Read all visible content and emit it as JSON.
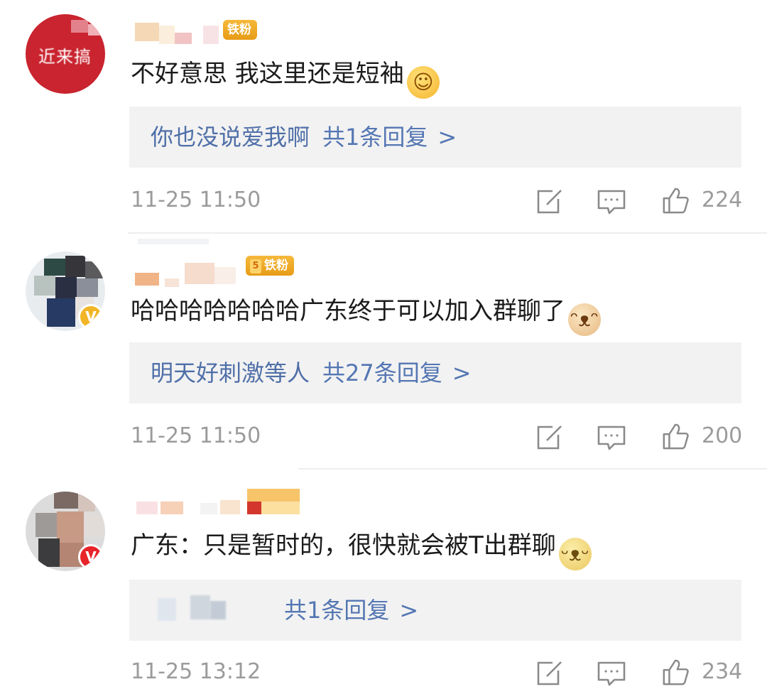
{
  "badges": {
    "fan_label": "铁粉",
    "fan_level": "5",
    "verified_mark": "V"
  },
  "comments": [
    {
      "avatar_text": "近来搞",
      "text": "不好意思 我这里还是短袖",
      "emoji": "smile-emoji",
      "reply": {
        "author": "你也没说爱我啊",
        "count": "共1条回复"
      },
      "time": "11-25 11:50",
      "likes": "224"
    },
    {
      "text": "哈哈哈哈哈哈哈广东终于可以加入群聊了",
      "emoji": "cat-emoji",
      "reply": {
        "author": "明天好刺激等人",
        "count": "共27条回复"
      },
      "time": "11-25 11:50",
      "likes": "200"
    },
    {
      "text": "广东：只是暂时的，很快就会被T出群聊",
      "emoji": "doge-emoji",
      "reply": {
        "author": "",
        "count": "共1条回复"
      },
      "time": "11-25 13:12",
      "likes": "234"
    }
  ],
  "reply_chevron": ">",
  "icons": {
    "share": "share-edit-icon",
    "comment": "comment-icon",
    "like": "thumbs-up-icon"
  },
  "colors": {
    "link": "#5476b3",
    "reply_bg": "#f2f2f2",
    "meta": "#9b9b9b",
    "fan_badge": "#f0a929",
    "verified_gold": "#f6b41d",
    "verified_red": "#e8232a"
  }
}
